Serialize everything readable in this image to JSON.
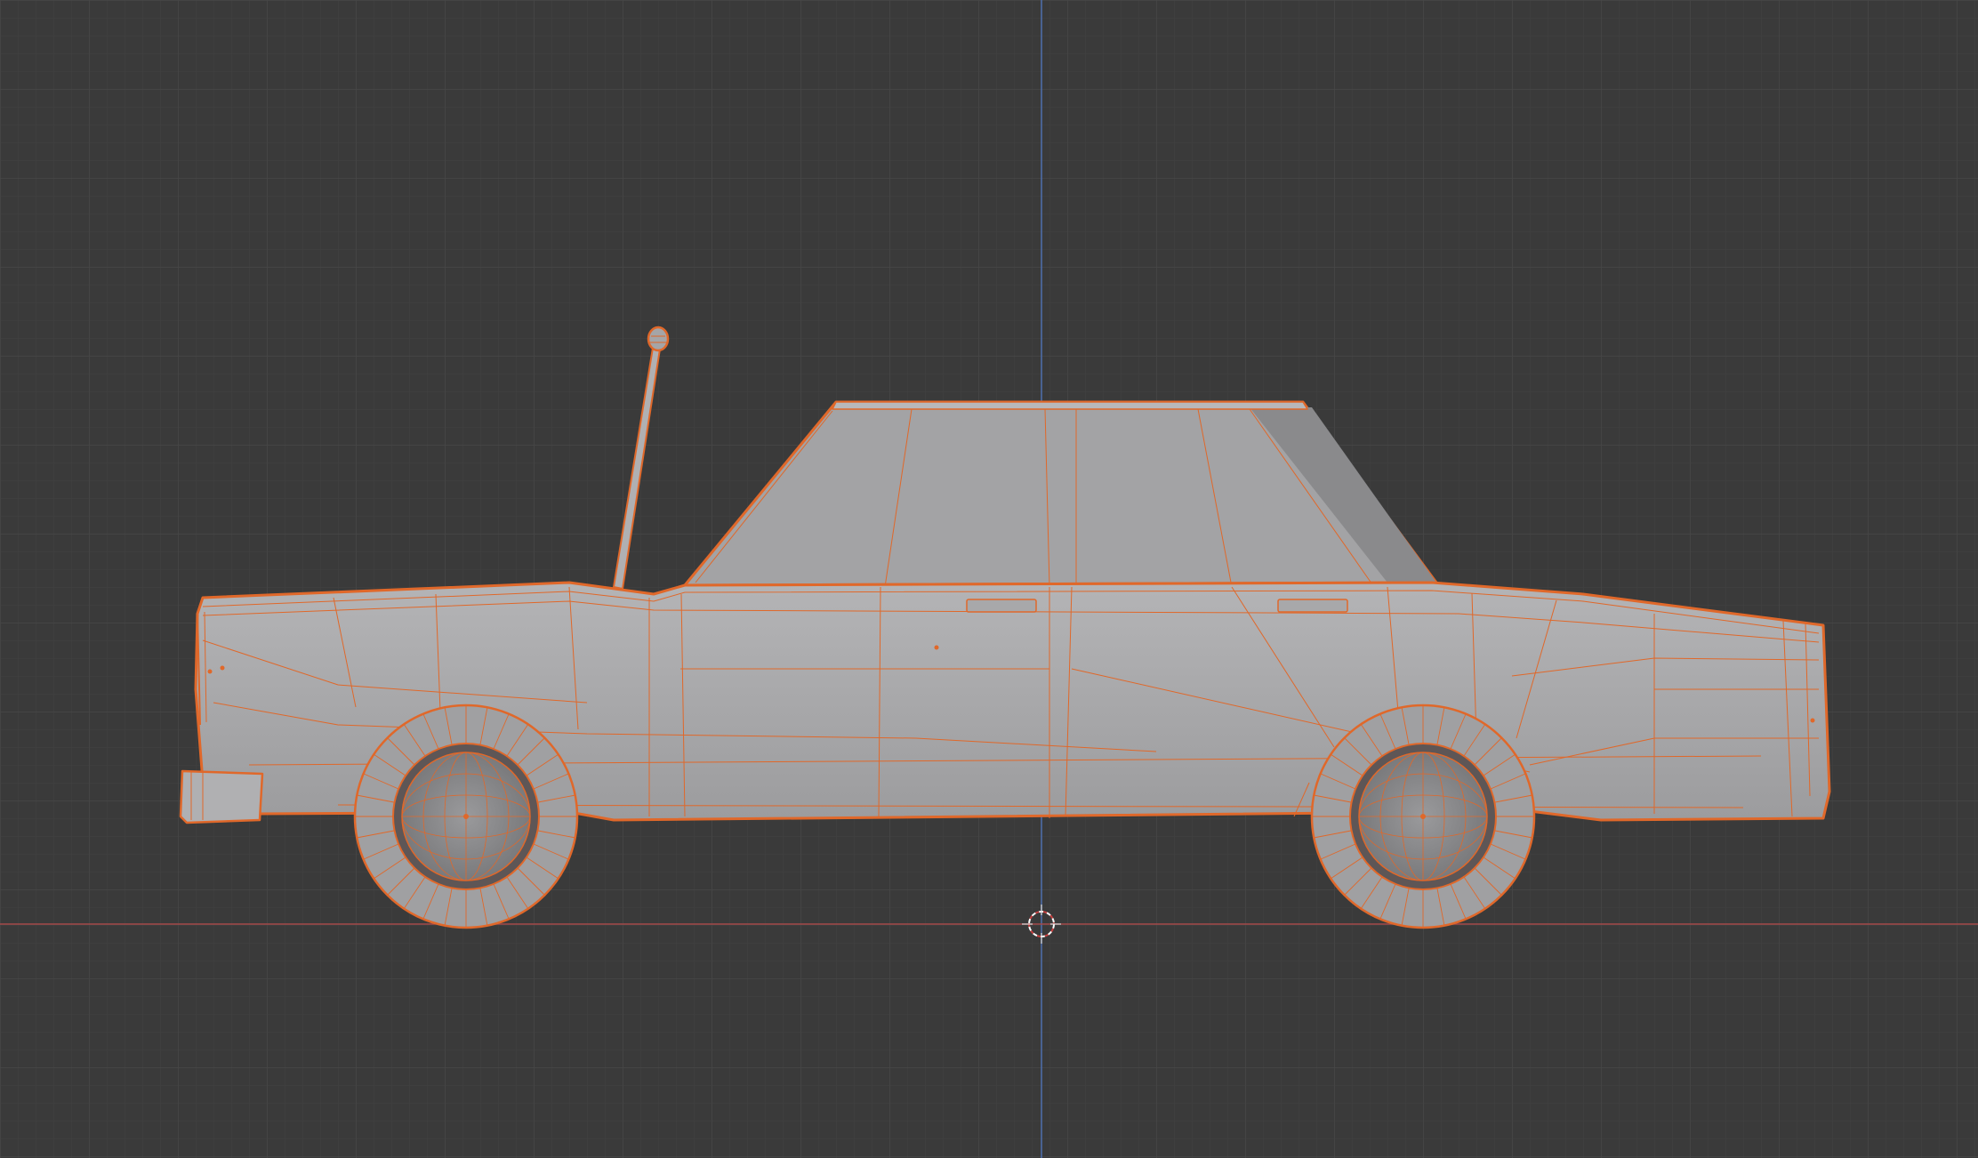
{
  "app": "3D viewport",
  "viewport": {
    "view": "side-orthographic",
    "shading": "solid",
    "overlay": "wireframe-on-selection",
    "background_color": "#3a3a3a",
    "grid_minor_color": "#414141",
    "grid_major_color": "#474747",
    "x_axis_color": "#a44a4a",
    "z_axis_color": "#4e6fae"
  },
  "object": {
    "name_visible": false,
    "selected": true,
    "selection_color": "#e0682a",
    "body_color": "#a9a9ab",
    "parts": [
      "body",
      "roof-cabin",
      "front-wheel",
      "rear-wheel",
      "antenna",
      "front-bumper",
      "door-handle-front",
      "door-handle-rear"
    ]
  },
  "scene": {
    "cursor_icon": "3d-cursor-icon",
    "origin_icon": "object-origin-icon"
  }
}
